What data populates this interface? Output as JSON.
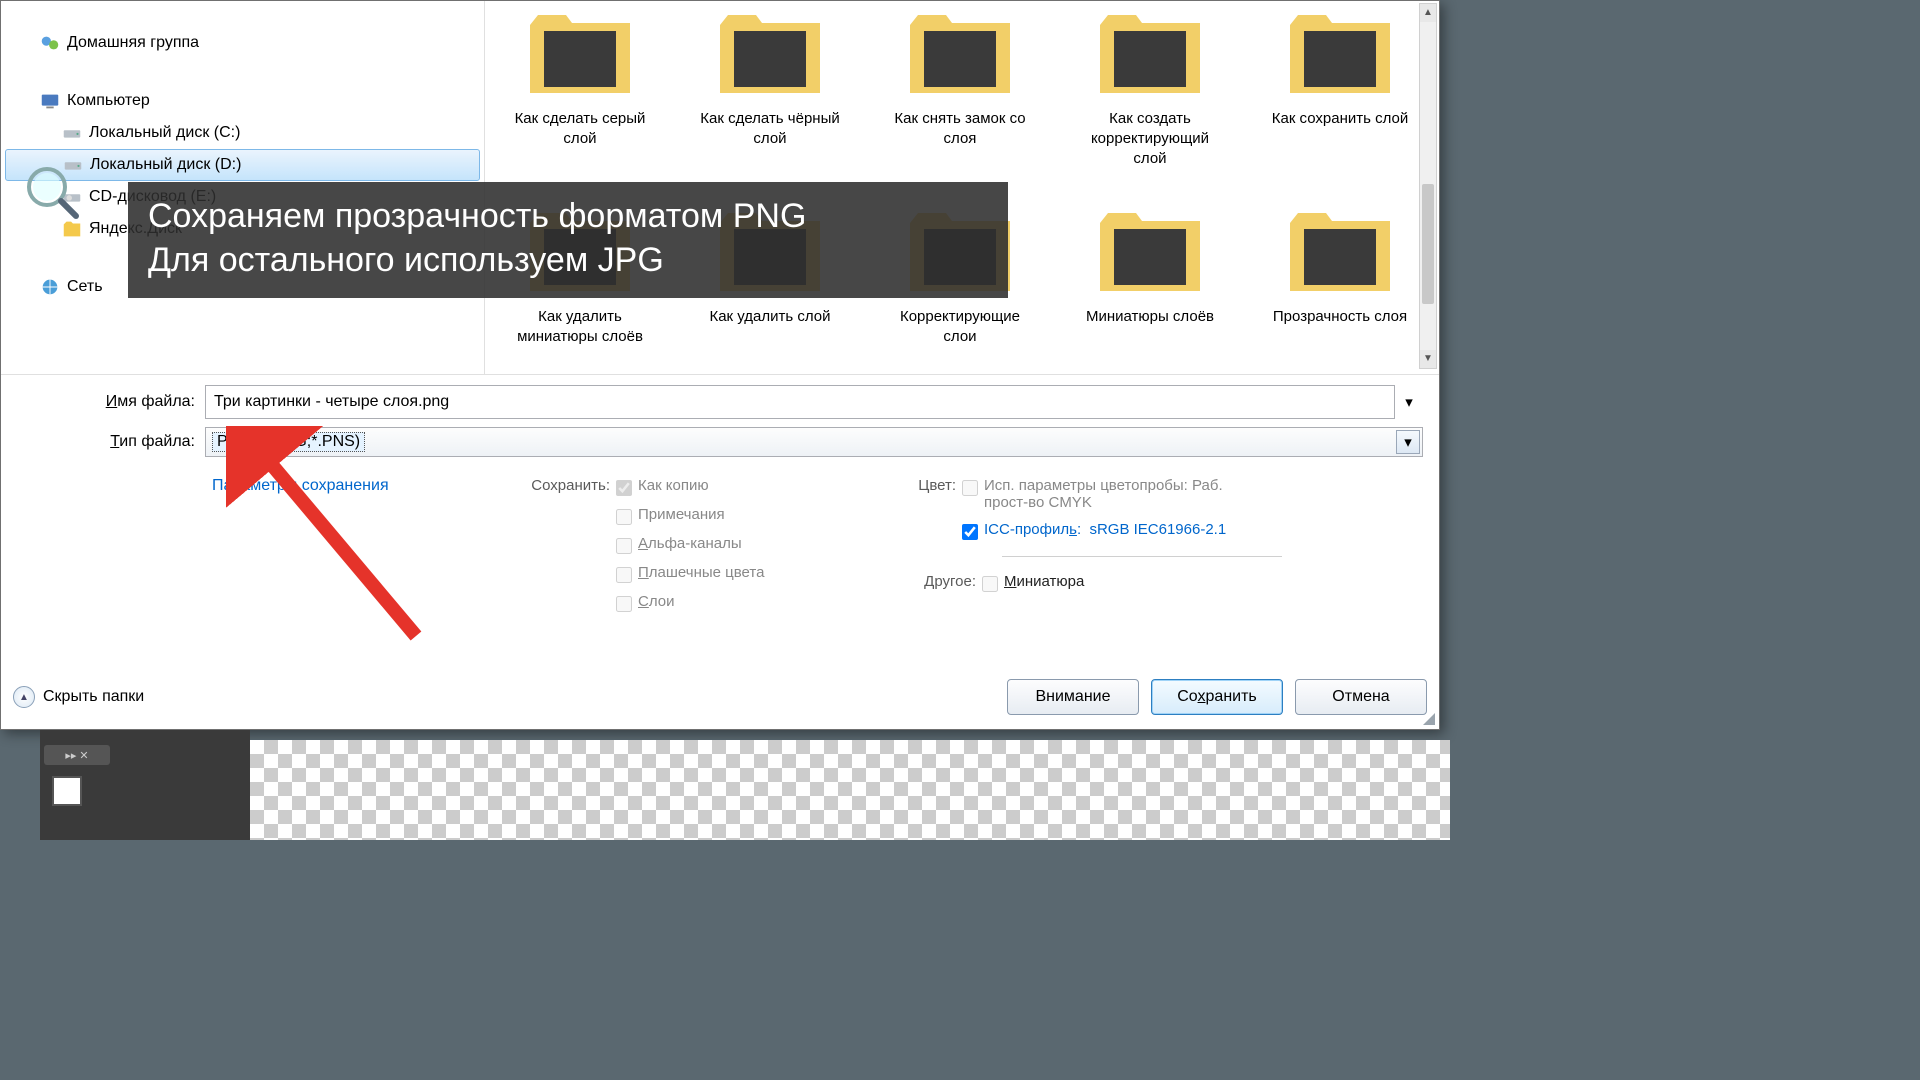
{
  "sidebar": {
    "items": [
      {
        "label": "Домашняя группа",
        "icon": "homegroup"
      },
      {
        "label": "Компьютер",
        "icon": "computer"
      },
      {
        "label": "Локальный диск (C:)",
        "icon": "drive"
      },
      {
        "label": "Локальный диск (D:)",
        "icon": "drive"
      },
      {
        "label": "CD-дисковод (E:)",
        "icon": "cd"
      },
      {
        "label": "Яндекс.Диск",
        "icon": "folder"
      },
      {
        "label": "Сеть",
        "icon": "network"
      }
    ]
  },
  "files": {
    "row1": [
      "Как сделать серый слой",
      "Как сделать чёрный слой",
      "Как снять замок со слоя",
      "Как создать корректирующий слой",
      "Как сохранить слой"
    ],
    "row2": [
      "Как удалить миниатюры слоёв",
      "Как удалить слой",
      "Корректирующие слои",
      "Миниатюры слоёв",
      "Прозрачность слоя"
    ]
  },
  "form": {
    "filename_label": "Имя файла:",
    "filename_value": "Три картинки - четыре слоя.png",
    "filetype_label": "Тип файла:",
    "filetype_value": "PNG (*.PNG;*.PNS)"
  },
  "options": {
    "save_params": "Параметры сохранения",
    "save_hdr": "Сохранить:",
    "as_copy": "Как копию",
    "notes": "Примечания",
    "alpha": "Альфа-каналы",
    "spot": "Плашечные цвета",
    "layers": "Слои",
    "color_hdr": "Цвет:",
    "proof": "Исп. параметры цветопробы:  Раб. прост-во CMYK",
    "icc": "ICC-профиль:  sRGB IEC61966-2.1",
    "other_hdr": "Другое:",
    "thumb": "Миниатюра"
  },
  "footer": {
    "hide": "Скрыть папки",
    "warn": "Внимание",
    "save": "Сохранить",
    "cancel": "Отмена"
  },
  "overlay": {
    "line1": "Сохраняем прозрачность форматом PNG",
    "line2": "Для остального используем JPG"
  }
}
